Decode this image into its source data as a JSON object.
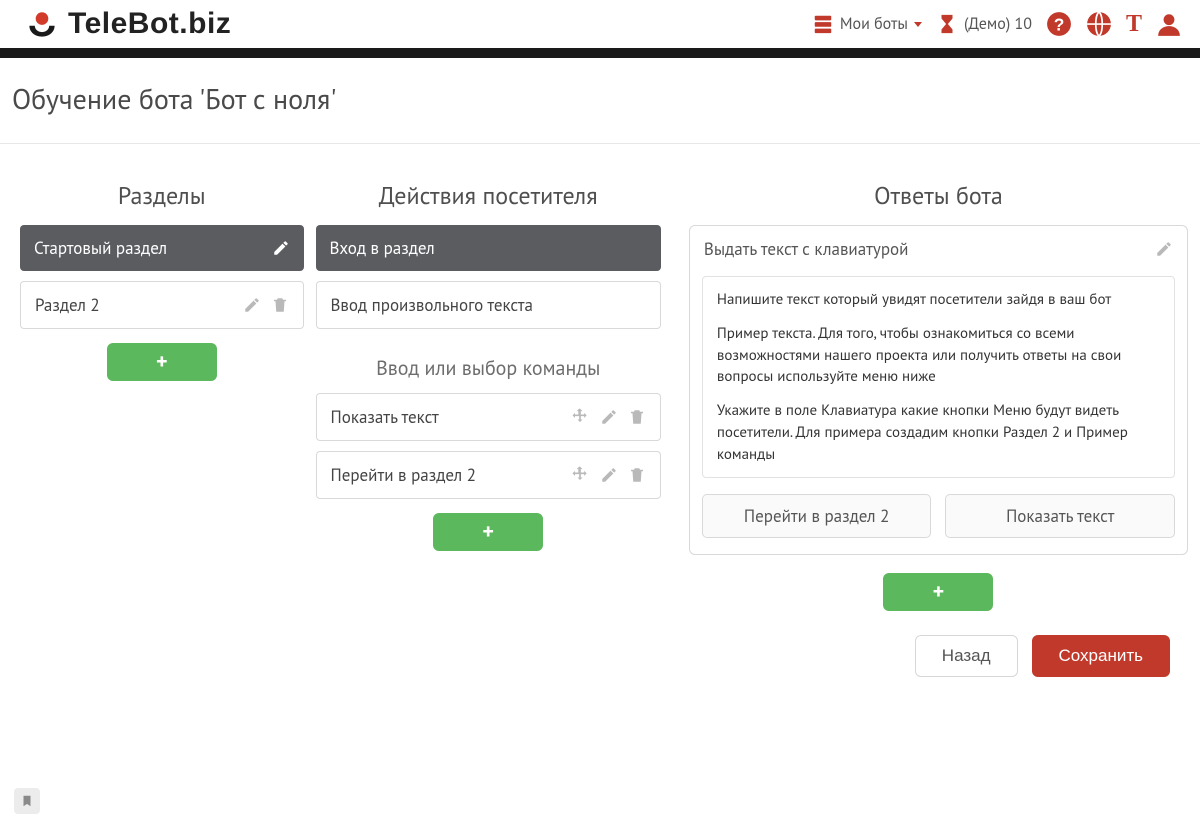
{
  "brand": {
    "name": "TeleBot.biz"
  },
  "header": {
    "my_bots_label": "Мои боты",
    "demo_label": "(Демо) 10"
  },
  "page": {
    "title": "Обучение бота 'Бот с ноля'"
  },
  "sections": {
    "title": "Разделы",
    "items": [
      {
        "label": "Стартовый раздел",
        "active": true
      },
      {
        "label": "Раздел 2",
        "active": false
      }
    ]
  },
  "actions": {
    "title": "Действия посетителя",
    "enter_label": "Вход в раздел",
    "freeform_label": "Ввод произвольного текста",
    "commands_subhead": "Ввод или выбор команды",
    "commands": [
      {
        "label": "Показать текст"
      },
      {
        "label": "Перейти в раздел 2"
      }
    ]
  },
  "answers": {
    "title": "Ответы бота",
    "head_label": "Выдать текст с клавиатурой",
    "body": {
      "p1": "Напишите текст который увидят посетители зайдя в ваш бот",
      "p2": "Пример текста. Для того, чтобы ознакомиться со всеми возможностями нашего проекта или получить ответы на свои вопросы используйте меню ниже",
      "p3": "Укажите в поле Клавиатура какие кнопки Меню будут видеть посетители. Для примера создадим кнопки Раздел 2 и Пример команды"
    },
    "kb_buttons": [
      {
        "label": "Перейти в раздел 2"
      },
      {
        "label": "Показать текст"
      }
    ]
  },
  "footer": {
    "back": "Назад",
    "save": "Сохранить"
  },
  "colors": {
    "accent": "#c0392b",
    "success": "#5cb85c",
    "panel_dark": "#5b5c60"
  }
}
